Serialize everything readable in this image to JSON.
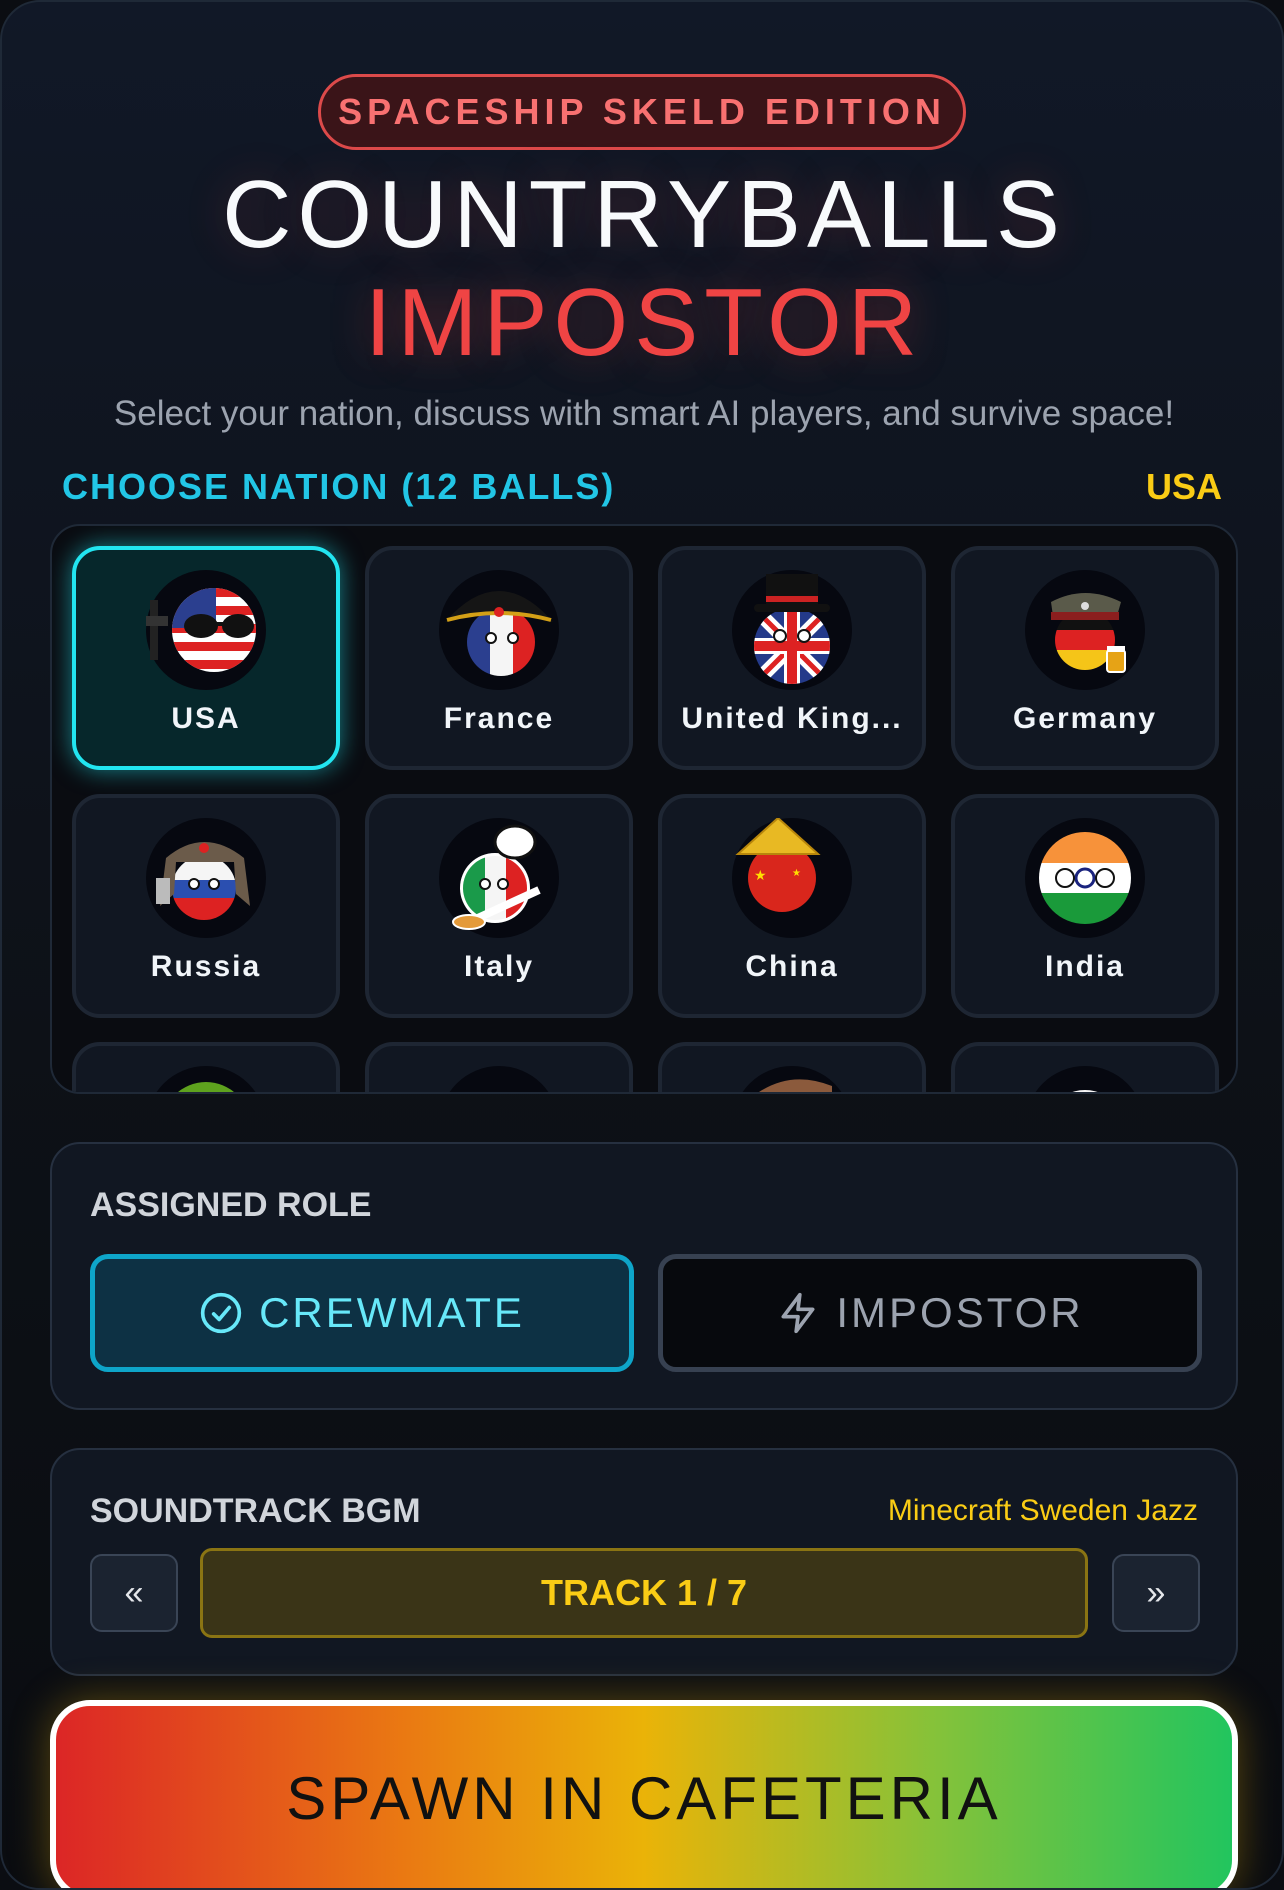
{
  "header": {
    "edition_badge": "SPACESHIP SKELD EDITION",
    "title_line1": "COUNTRYBALLS",
    "title_line2": "IMPOSTOR",
    "subtitle": "Select your nation, discuss with smart AI players, and survive space!"
  },
  "nation_picker": {
    "heading": "CHOOSE NATION (12 BALLS)",
    "selected": "USA",
    "nations": [
      {
        "label": "USA",
        "icon": "usa-ball-icon",
        "selected": true
      },
      {
        "label": "France",
        "icon": "france-ball-icon"
      },
      {
        "label": "United King...",
        "icon": "uk-ball-icon"
      },
      {
        "label": "Germany",
        "icon": "germany-ball-icon"
      },
      {
        "label": "Russia",
        "icon": "russia-ball-icon"
      },
      {
        "label": "Italy",
        "icon": "italy-ball-icon"
      },
      {
        "label": "China",
        "icon": "china-ball-icon"
      },
      {
        "label": "India",
        "icon": "india-ball-icon"
      }
    ]
  },
  "role": {
    "heading": "ASSIGNED ROLE",
    "crewmate_label": "CREWMATE",
    "impostor_label": "IMPOSTOR",
    "selected": "CREWMATE"
  },
  "soundtrack": {
    "heading": "SOUNDTRACK BGM",
    "track_name": "Minecraft Sweden Jazz",
    "track_label": "TRACK 1 / 7",
    "prev_label": "«",
    "next_label": "»"
  },
  "spawn_button": "SPAWN IN CAFETERIA",
  "colors": {
    "accent_cyan": "#22e5f0",
    "accent_red": "#ef4444",
    "accent_yellow": "#facc15"
  }
}
